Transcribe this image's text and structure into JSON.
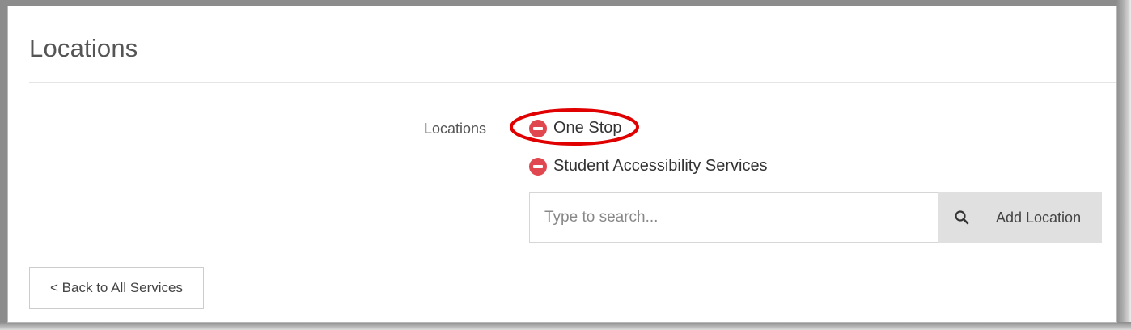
{
  "section": {
    "title": "Locations"
  },
  "locations_field": {
    "label": "Locations",
    "items": [
      {
        "name": "One Stop",
        "highlighted": true
      },
      {
        "name": "Student Accessibility Services",
        "highlighted": false
      }
    ]
  },
  "search": {
    "placeholder": "Type to search...",
    "value": "",
    "add_label": "Add Location",
    "icon": "search-icon"
  },
  "navigation": {
    "back_label": "< Back to All Services"
  },
  "colors": {
    "remove_icon": "#e0474f",
    "highlight_ring": "#e00000",
    "button_gray": "#e0e0e0"
  }
}
